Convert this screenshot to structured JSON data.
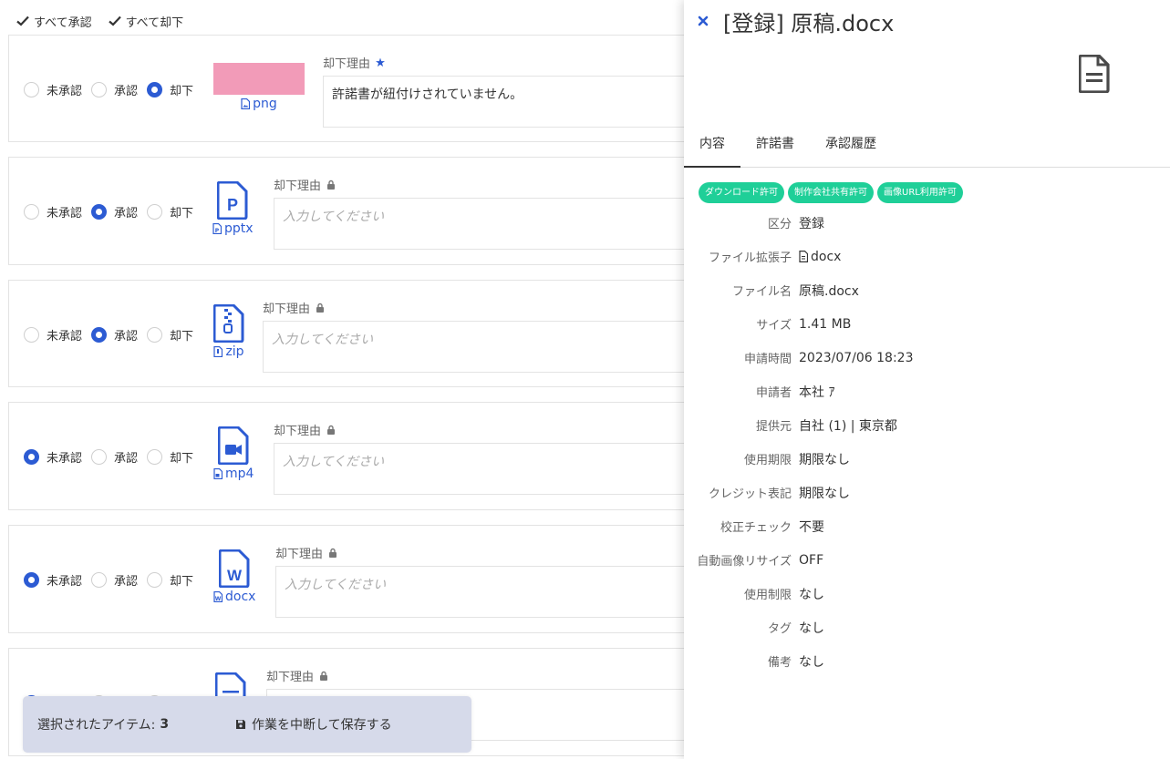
{
  "toolbar": {
    "approve_all": "すべて承認",
    "reject_all": "すべて却下"
  },
  "radio_labels": {
    "pending": "未承認",
    "approved": "承認",
    "rejected": "却下"
  },
  "reason_label": "却下理由",
  "rows": [
    {
      "selected": "rejected",
      "filetype": "png",
      "icon": "image-thumbnail",
      "reason": "許諾書が紐付けされていません。",
      "required": true
    },
    {
      "selected": "approved",
      "filetype": "pptx",
      "icon": "powerpoint-file-icon",
      "reason_placeholder": "入力してください",
      "locked": true
    },
    {
      "selected": "approved",
      "filetype": "zip",
      "icon": "zip-file-icon",
      "reason_placeholder": "入力してください",
      "locked": true
    },
    {
      "selected": "pending",
      "filetype": "mp4",
      "icon": "video-file-icon",
      "reason_placeholder": "入力してください",
      "locked": true
    },
    {
      "selected": "pending",
      "filetype": "docx",
      "icon": "word-file-icon",
      "reason_placeholder": "入力してください",
      "locked": true
    },
    {
      "selected": "pending",
      "filetype": "",
      "icon": "document-file-icon",
      "reason_placeholder": "",
      "locked": true
    }
  ],
  "bottombar": {
    "selected_label": "選択されたアイテム:",
    "selected_count": "3",
    "save_label": "作業を中断して保存する"
  },
  "panel": {
    "title": "[登録] 原稿.docx",
    "tabs": [
      {
        "label": "内容",
        "active": true
      },
      {
        "label": "許諾書"
      },
      {
        "label": "承認履歴"
      }
    ],
    "badges": [
      "ダウンロード許可",
      "制作会社共有許可",
      "画像URL利用許可"
    ],
    "info": [
      {
        "label": "区分",
        "value": "登録"
      },
      {
        "label": "ファイル拡張子",
        "value": "docx"
      },
      {
        "label": "ファイル名",
        "value": "原稿.docx"
      },
      {
        "label": "サイズ",
        "value": "1.41 MB"
      },
      {
        "label": "申請時間",
        "value": "2023/07/06 18:23"
      },
      {
        "label": "申請者",
        "value": "本社 ｱ"
      },
      {
        "label": "提供元",
        "value": "自社 (1) | 東京都"
      },
      {
        "label": "使用期限",
        "value": "期限なし"
      },
      {
        "label": "クレジット表記",
        "value": "期限なし"
      },
      {
        "label": "校正チェック",
        "value": "不要"
      },
      {
        "label": "自動画像リサイズ",
        "value": "OFF"
      },
      {
        "label": "使用制限",
        "value": "なし"
      },
      {
        "label": "タグ",
        "value": "なし"
      },
      {
        "label": "備考",
        "value": "なし"
      }
    ]
  },
  "colors": {
    "accent": "#2c5bd3",
    "badge": "#1fcf98",
    "bottombar": "#d6daea",
    "thumbnail": "#f29bb8"
  }
}
